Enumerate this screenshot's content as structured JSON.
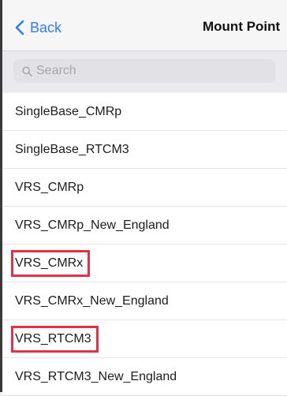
{
  "nav": {
    "back_label": "Back",
    "title": "Mount Point",
    "accent": "#2f7cf6"
  },
  "search": {
    "placeholder": "Search",
    "icon": "search-icon"
  },
  "mount_points": [
    {
      "label": "SingleBase_CMRp",
      "highlighted": false
    },
    {
      "label": "SingleBase_RTCM3",
      "highlighted": false
    },
    {
      "label": "VRS_CMRp",
      "highlighted": false
    },
    {
      "label": "VRS_CMRp_New_England",
      "highlighted": false
    },
    {
      "label": "VRS_CMRx",
      "highlighted": true
    },
    {
      "label": "VRS_CMRx_New_England",
      "highlighted": false
    },
    {
      "label": "VRS_RTCM3",
      "highlighted": true
    },
    {
      "label": "VRS_RTCM3_New_England",
      "highlighted": false
    }
  ],
  "highlight_color": "#e33247"
}
